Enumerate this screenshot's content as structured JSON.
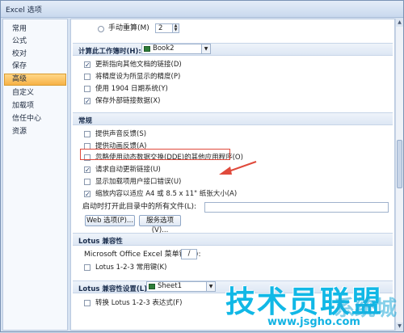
{
  "window": {
    "title": "Excel 选项"
  },
  "sidebar": {
    "items": [
      {
        "label": "常用"
      },
      {
        "label": "公式"
      },
      {
        "label": "校对"
      },
      {
        "label": "保存"
      },
      {
        "label": "高级",
        "active": true
      },
      {
        "label": "自定义"
      },
      {
        "label": "加载项"
      },
      {
        "label": "信任中心"
      },
      {
        "label": "资源"
      }
    ]
  },
  "calc": {
    "manual_label": "手动重算(M)",
    "manual_value": "2"
  },
  "workbook_section": {
    "label": "计算此工作簿时(H):",
    "workbook_select": "Book2",
    "options": [
      {
        "label": "更新指向其他文档的链接(D)",
        "checked": true
      },
      {
        "label": "将精度设为所显示的精度(P)",
        "checked": false
      },
      {
        "label": "使用 1904 日期系统(Y)",
        "checked": false
      },
      {
        "label": "保存外部链接数据(X)",
        "checked": true
      }
    ]
  },
  "general_section": {
    "label": "常规",
    "options": [
      {
        "label": "提供声音反馈(S)",
        "checked": false
      },
      {
        "label": "提供动画反馈(A)",
        "checked": false
      },
      {
        "label": "忽略使用动态数据交换(DDE)的其他应用程序(O)",
        "checked": false
      },
      {
        "label": "请求自动更新链接(U)",
        "checked": true
      },
      {
        "label": "显示加载项用户接口错误(U)",
        "checked": false
      },
      {
        "label": "缩放内容以适应 A4 或 8.5 x 11\" 纸张大小(A)",
        "checked": true
      }
    ],
    "startup_label": "启动时打开此目录中的所有文件(L):",
    "web_options_button": "Web 选项(P)...",
    "service_options_button": "服务选项(V)..."
  },
  "lotus_section": {
    "label": "Lotus 兼容性",
    "menu_key_label": "Microsoft Office Excel 菜单键(M):",
    "menu_key_value": "/",
    "nav_keys_label": "Lotus 1-2-3 常用键(K)",
    "nav_keys_checked": false
  },
  "lotus_settings_section": {
    "label": "Lotus 兼容性设置(L):",
    "sheet_select": "Sheet1",
    "formula_label": "转换 Lotus 1-2-3 表达式(F)",
    "formula_checked": false
  },
  "watermark": {
    "text": "技术员联盟",
    "url": "www.jsgho.com",
    "overlay": "系统城"
  },
  "colors": {
    "accent_active": "#f7b247",
    "highlight_border": "#e04a3c",
    "watermark": "#11b8e6"
  }
}
